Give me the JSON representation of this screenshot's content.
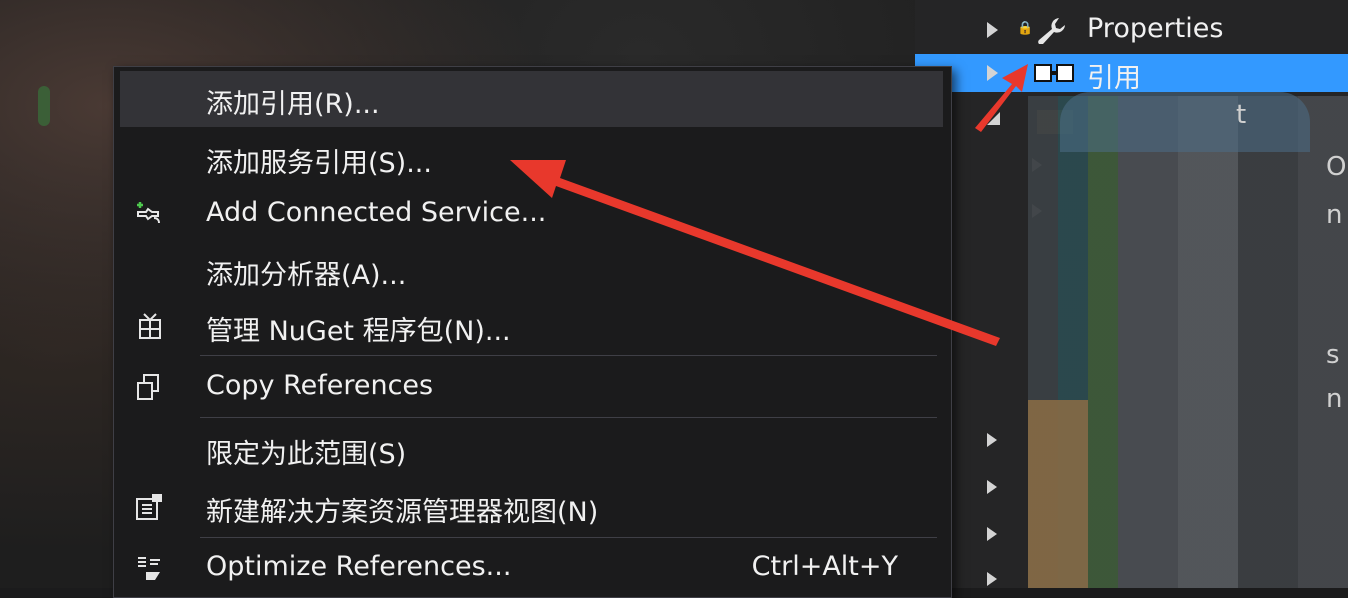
{
  "explorer": {
    "items": [
      {
        "label": "Properties",
        "icon": "wrench-icon"
      },
      {
        "label": "引用",
        "icon": "references-icon",
        "selected": true
      }
    ],
    "partial_text": [
      "t",
      "O",
      "n",
      "s",
      "n"
    ]
  },
  "context_menu": {
    "items": [
      {
        "label": "添加引用(R)...",
        "icon": null,
        "highlighted": true
      },
      {
        "label": "添加服务引用(S)...",
        "icon": null
      },
      {
        "label": "Add Connected Service...",
        "icon": "connected-service-icon"
      },
      {
        "label": "添加分析器(A)...",
        "icon": null
      },
      {
        "label": "管理 NuGet 程序包(N)...",
        "icon": "nuget-package-icon"
      },
      {
        "label": "Copy References",
        "icon": "copy-icon"
      },
      {
        "label": "限定为此范围(S)",
        "icon": null
      },
      {
        "label": "新建解决方案资源管理器视图(N)",
        "icon": "new-explorer-view-icon"
      },
      {
        "label": "Optimize References...",
        "icon": "optimize-references-icon",
        "shortcut": "Ctrl+Alt+Y"
      }
    ]
  },
  "colors": {
    "selection": "#3399ff",
    "menu_bg": "#1b1b1c",
    "menu_hover": "#333337",
    "annotation_arrow": "#e8382c"
  }
}
